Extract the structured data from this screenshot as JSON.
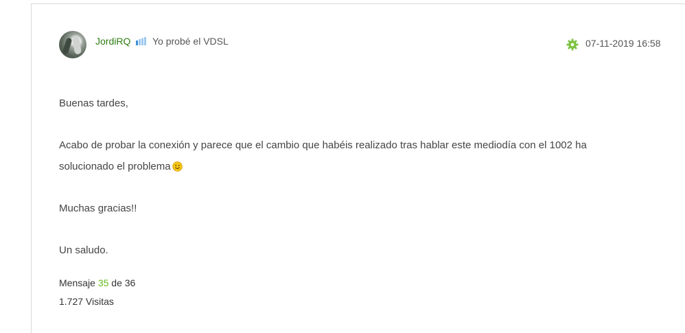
{
  "author": {
    "name": "JordiRQ",
    "rank": "Yo probé el VDSL"
  },
  "post": {
    "timestamp": "07-11-2019 16:58",
    "paragraphs": {
      "greeting": "Buenas tardes,",
      "line1": "Acabo de probar la conexión y parece que el cambio que habéis realizado tras hablar este mediodía con el 1002 ha",
      "line2": "solucionado el problema",
      "thanks": "Muchas gracias!!",
      "closing": "Un saludo."
    }
  },
  "message_meta": {
    "prefix": "Mensaje",
    "number": "35",
    "of_label": "de 36",
    "views": "1.727 Visitas"
  },
  "colors": {
    "username": "#2e7d12",
    "accent_green": "#66bb22",
    "rank_bar_filled": "#3a8fd8",
    "rank_bar_empty": "#9cc8ee"
  },
  "icons": {
    "gear": "gear-icon",
    "rank": "signal-bars-icon",
    "emoji": "smiley-icon"
  }
}
